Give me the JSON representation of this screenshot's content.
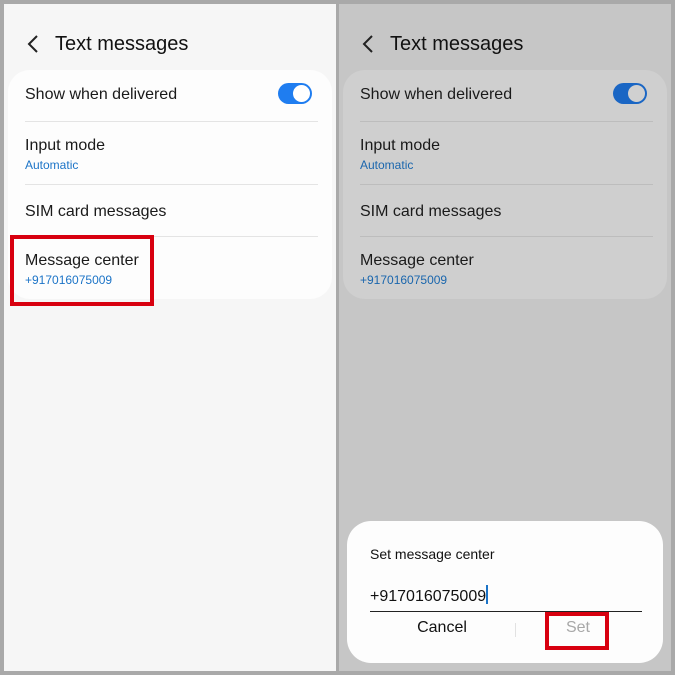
{
  "header": {
    "title": "Text messages",
    "back_icon": "chevron-left-icon"
  },
  "settings": {
    "show_when_delivered": {
      "label": "Show when delivered",
      "enabled": true
    },
    "input_mode": {
      "label": "Input mode",
      "value": "Automatic"
    },
    "sim_card_messages": {
      "label": "SIM card messages"
    },
    "message_center": {
      "label": "Message center",
      "value": "+917016075009"
    }
  },
  "dialog": {
    "title": "Set message center",
    "input_value": "+917016075009",
    "cancel_label": "Cancel",
    "set_label": "Set"
  },
  "colors": {
    "accent": "#1f7df0",
    "highlight": "#d8000f"
  }
}
